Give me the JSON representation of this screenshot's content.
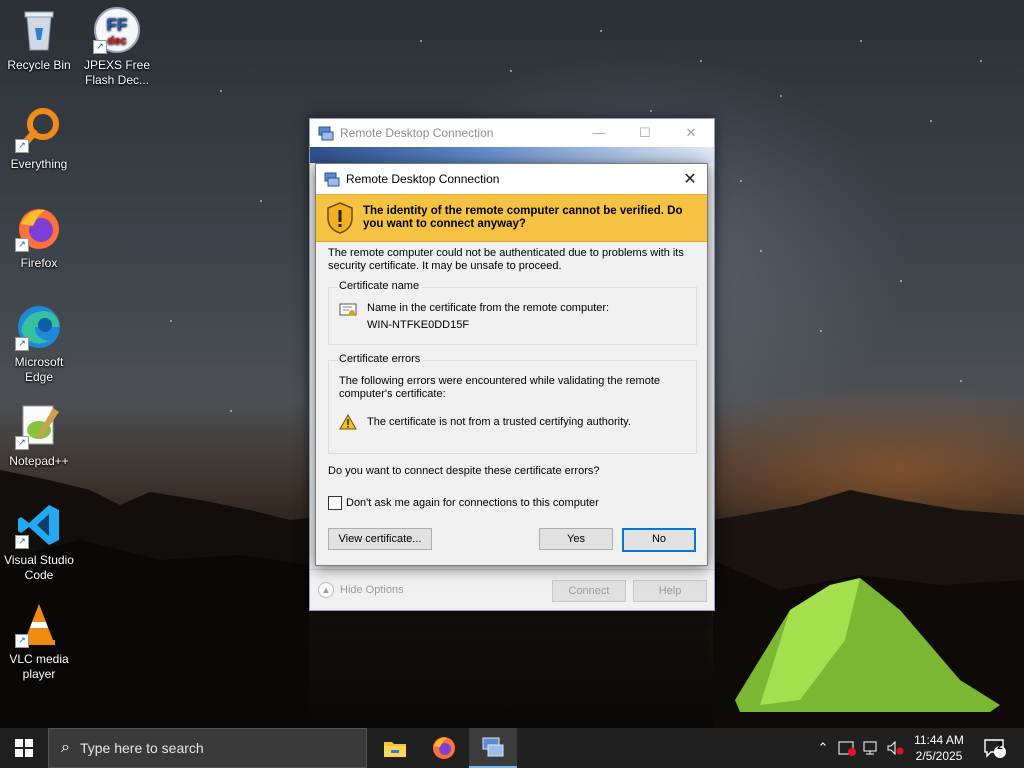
{
  "desktop_icons": [
    {
      "label": "Recycle Bin",
      "icon": "recycle-bin-icon"
    },
    {
      "label": "JPEXS Free Flash Dec...",
      "icon": "jpexs-icon",
      "badge": "FF dec"
    },
    {
      "label": "Everything",
      "icon": "everything-search-icon"
    },
    {
      "label": "Firefox",
      "icon": "firefox-icon"
    },
    {
      "label": "Microsoft Edge",
      "icon": "edge-icon"
    },
    {
      "label": "Notepad++",
      "icon": "notepadpp-icon"
    },
    {
      "label": "Visual Studio Code",
      "icon": "vscode-icon"
    },
    {
      "label": "VLC media player",
      "icon": "vlc-icon"
    }
  ],
  "background_window": {
    "title": "Remote Desktop Connection",
    "hide_options_label": "Hide Options",
    "connect_label": "Connect",
    "help_label": "Help"
  },
  "dialog": {
    "title": "Remote Desktop Connection",
    "warning": "The identity of the remote computer cannot be verified. Do you want to connect anyway?",
    "intro": "The remote computer could not be authenticated due to problems with its security certificate. It may be unsafe to proceed.",
    "cert_name_group": {
      "legend": "Certificate name",
      "description": "Name in the certificate from the remote computer:",
      "value": "WIN-NTFKE0DD15F"
    },
    "cert_errors_group": {
      "legend": "Certificate errors",
      "description": "The following errors were encountered while validating the remote computer's certificate:",
      "error": "The certificate is not from a trusted certifying authority."
    },
    "question": "Do you want to connect despite these certificate errors?",
    "dont_ask_label": "Don't ask me again for connections to this computer",
    "dont_ask_checked": false,
    "view_certificate_label": "View certificate...",
    "yes_label": "Yes",
    "no_label": "No"
  },
  "taskbar": {
    "search_placeholder": "Type here to search",
    "apps": [
      "file-explorer-icon",
      "firefox-icon",
      "remote-desktop-icon"
    ],
    "active_app": "remote-desktop-icon",
    "clock_time": "11:44 AM",
    "clock_date": "2/5/2025",
    "notification_count": "2"
  },
  "colors": {
    "warning_bar": "#f6c243",
    "default_button_border": "#0078d7",
    "taskbar": "#202020"
  }
}
